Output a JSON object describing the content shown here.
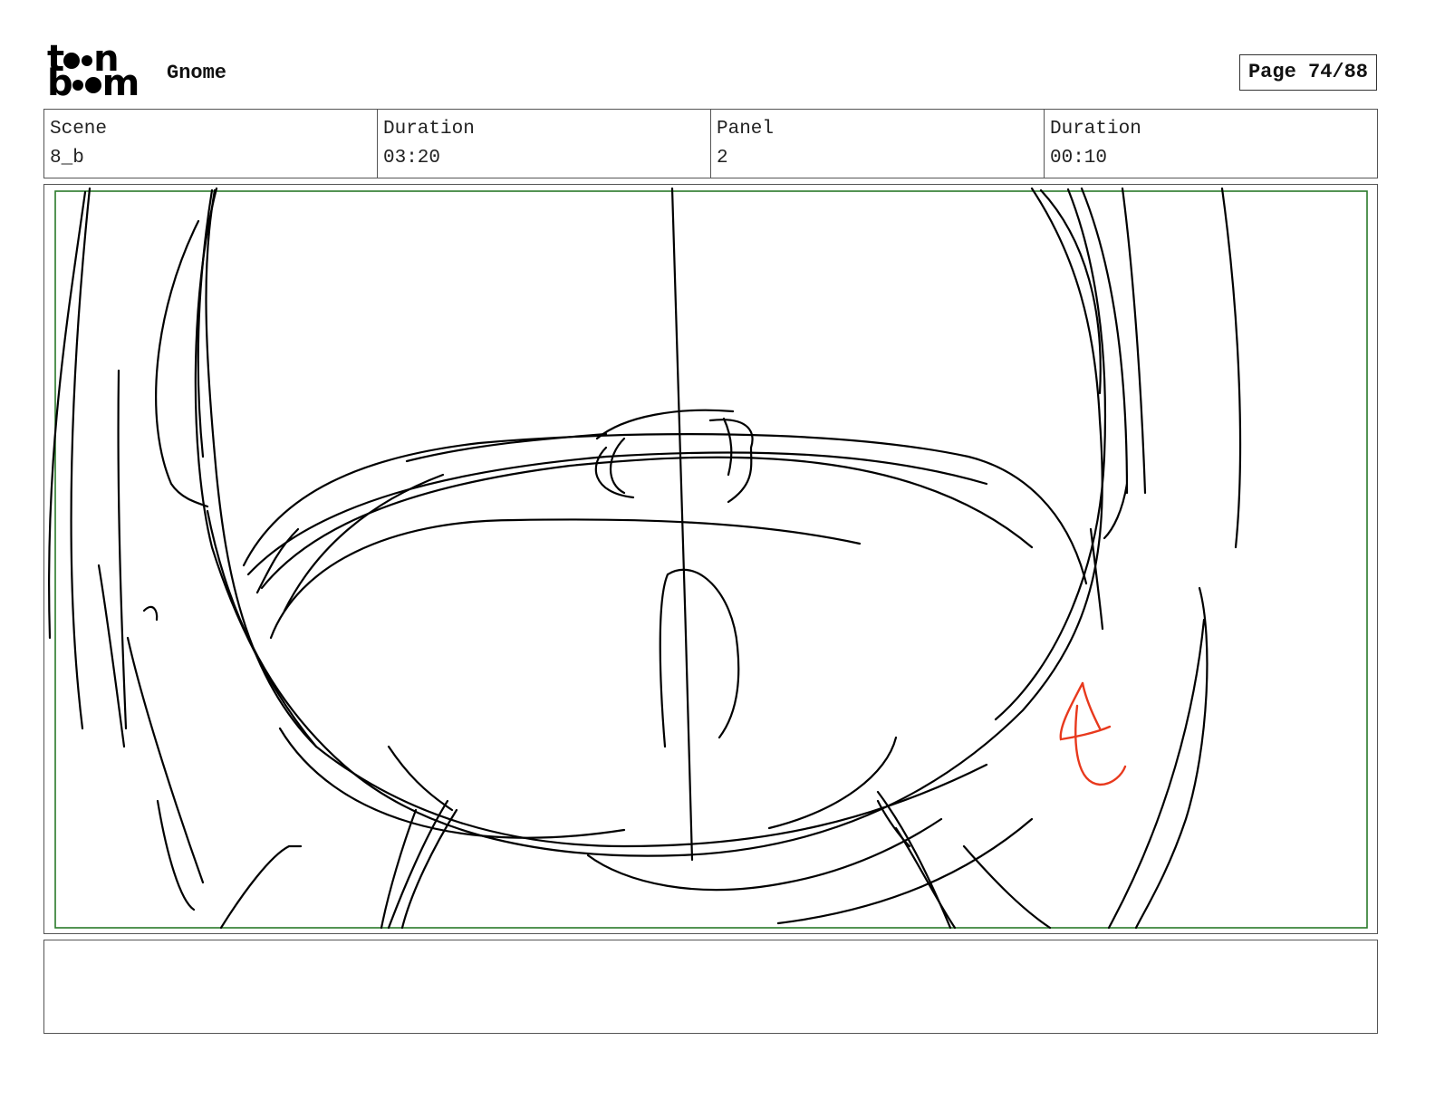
{
  "header": {
    "logo_text": "toonboom",
    "project_title": "Gnome",
    "page_label": "Page 74/88"
  },
  "info": {
    "scene_label": "Scene",
    "scene_value": "8_b",
    "scene_duration_label": "Duration",
    "scene_duration_value": "03:20",
    "panel_label": "Panel",
    "panel_value": "2",
    "panel_duration_label": "Duration",
    "panel_duration_value": "00:10"
  },
  "panel": {
    "safe_frame_color": "#2a7a2a",
    "sketch_color": "#000000",
    "annotation_color": "#e8391d"
  },
  "notes": {
    "text": ""
  }
}
